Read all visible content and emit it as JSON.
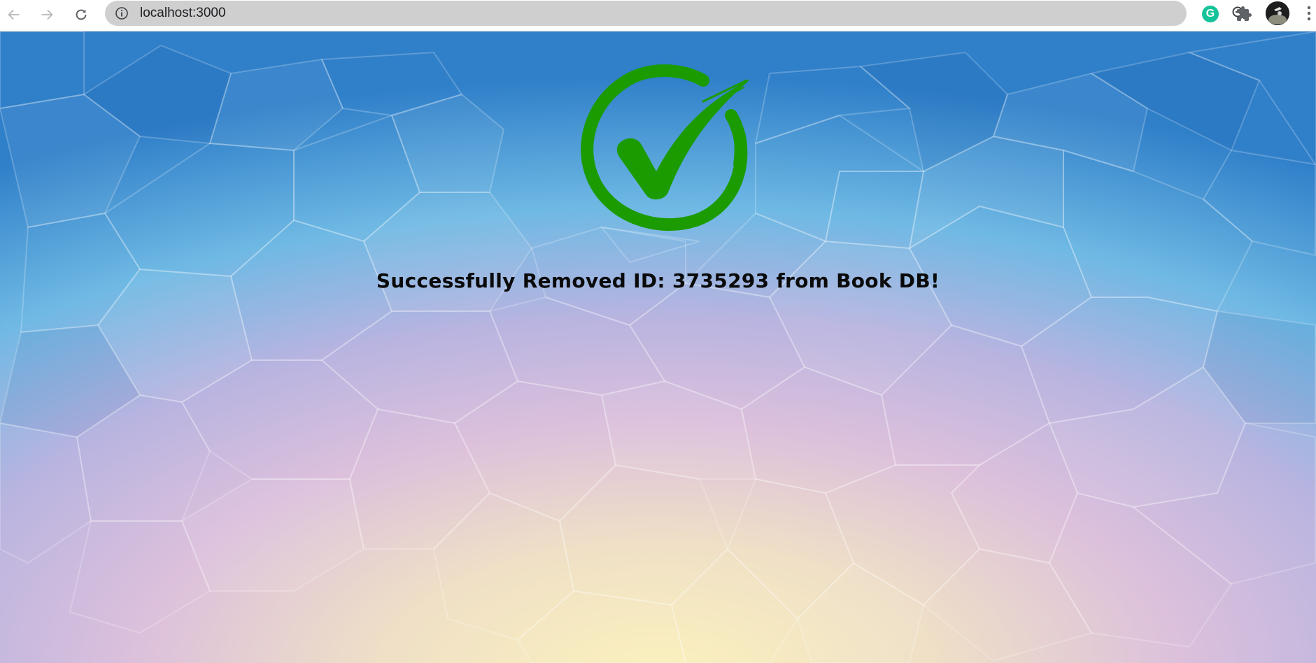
{
  "browser": {
    "url": "localhost:3000",
    "grammarly_letter": "G"
  },
  "page": {
    "message": "Successfully Removed ID: 3735293 from Book DB!"
  },
  "icons": {
    "back": "arrow-left-icon",
    "forward": "arrow-right-icon",
    "reload": "reload-icon",
    "site_info": "info-icon",
    "zoom": "zoom-out-icon",
    "bookmark": "star-icon",
    "extensions": "puzzle-icon",
    "menu": "kebab-menu-icon",
    "success": "check-circle-icon"
  },
  "colors": {
    "check_green": "#1b9b00",
    "omnibox_bg": "#cfcfcf",
    "grammarly": "#15c39a"
  }
}
